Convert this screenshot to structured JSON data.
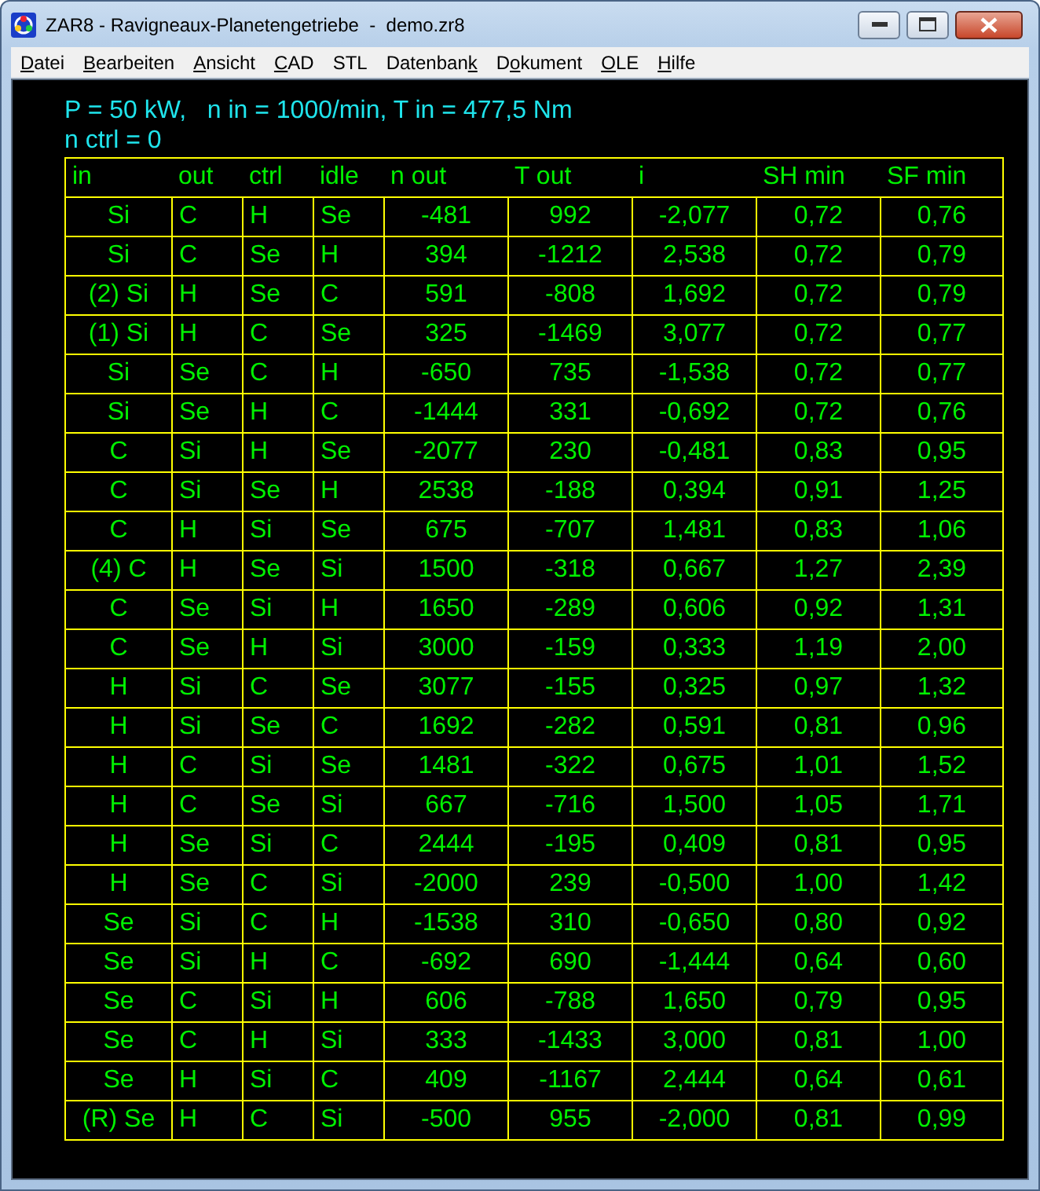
{
  "window": {
    "title": "ZAR8 - Ravigneaux-Planetengetriebe  -  demo.zr8"
  },
  "menu": [
    {
      "parts": [
        {
          "t": "D",
          "key": true
        },
        {
          "t": "atei",
          "key": false
        }
      ]
    },
    {
      "parts": [
        {
          "t": "B",
          "key": true
        },
        {
          "t": "earbeiten",
          "key": false
        }
      ]
    },
    {
      "parts": [
        {
          "t": "A",
          "key": true
        },
        {
          "t": "nsicht",
          "key": false
        }
      ]
    },
    {
      "parts": [
        {
          "t": "C",
          "key": true
        },
        {
          "t": "AD",
          "key": false
        }
      ]
    },
    {
      "parts": [
        {
          "t": "STL",
          "key": false
        }
      ]
    },
    {
      "parts": [
        {
          "t": "Datenban",
          "key": false
        },
        {
          "t": "k",
          "key": true
        }
      ]
    },
    {
      "parts": [
        {
          "t": "D",
          "key": false
        },
        {
          "t": "o",
          "key": true
        },
        {
          "t": "kument",
          "key": false
        }
      ]
    },
    {
      "parts": [
        {
          "t": "O",
          "key": true
        },
        {
          "t": "LE",
          "key": false
        }
      ]
    },
    {
      "parts": [
        {
          "t": "H",
          "key": true
        },
        {
          "t": "ilfe",
          "key": false
        }
      ]
    }
  ],
  "summary": [
    "P = 50 kW,   n in = 1000/min, T in = 477,5 Nm",
    "n ctrl = 0"
  ],
  "table": {
    "columns": [
      "in",
      "out",
      "ctrl",
      "idle",
      "n out",
      "T out",
      "i",
      "SH min",
      "SF min"
    ],
    "rows": [
      [
        "Si",
        "C",
        "H",
        "Se",
        "-481",
        "992",
        "-2,077",
        "0,72",
        "0,76"
      ],
      [
        "Si",
        "C",
        "Se",
        "H",
        "394",
        "-1212",
        "2,538",
        "0,72",
        "0,79"
      ],
      [
        "(2) Si",
        "H",
        "Se",
        "C",
        "591",
        "-808",
        "1,692",
        "0,72",
        "0,79"
      ],
      [
        "(1) Si",
        "H",
        "C",
        "Se",
        "325",
        "-1469",
        "3,077",
        "0,72",
        "0,77"
      ],
      [
        "Si",
        "Se",
        "C",
        "H",
        "-650",
        "735",
        "-1,538",
        "0,72",
        "0,77"
      ],
      [
        "Si",
        "Se",
        "H",
        "C",
        "-1444",
        "331",
        "-0,692",
        "0,72",
        "0,76"
      ],
      [
        "C",
        "Si",
        "H",
        "Se",
        "-2077",
        "230",
        "-0,481",
        "0,83",
        "0,95"
      ],
      [
        "C",
        "Si",
        "Se",
        "H",
        "2538",
        "-188",
        "0,394",
        "0,91",
        "1,25"
      ],
      [
        "C",
        "H",
        "Si",
        "Se",
        "675",
        "-707",
        "1,481",
        "0,83",
        "1,06"
      ],
      [
        "(4) C",
        "H",
        "Se",
        "Si",
        "1500",
        "-318",
        "0,667",
        "1,27",
        "2,39"
      ],
      [
        "C",
        "Se",
        "Si",
        "H",
        "1650",
        "-289",
        "0,606",
        "0,92",
        "1,31"
      ],
      [
        "C",
        "Se",
        "H",
        "Si",
        "3000",
        "-159",
        "0,333",
        "1,19",
        "2,00"
      ],
      [
        "H",
        "Si",
        "C",
        "Se",
        "3077",
        "-155",
        "0,325",
        "0,97",
        "1,32"
      ],
      [
        "H",
        "Si",
        "Se",
        "C",
        "1692",
        "-282",
        "0,591",
        "0,81",
        "0,96"
      ],
      [
        "H",
        "C",
        "Si",
        "Se",
        "1481",
        "-322",
        "0,675",
        "1,01",
        "1,52"
      ],
      [
        "H",
        "C",
        "Se",
        "Si",
        "667",
        "-716",
        "1,500",
        "1,05",
        "1,71"
      ],
      [
        "H",
        "Se",
        "Si",
        "C",
        "2444",
        "-195",
        "0,409",
        "0,81",
        "0,95"
      ],
      [
        "H",
        "Se",
        "C",
        "Si",
        "-2000",
        "239",
        "-0,500",
        "1,00",
        "1,42"
      ],
      [
        "Se",
        "Si",
        "C",
        "H",
        "-1538",
        "310",
        "-0,650",
        "0,80",
        "0,92"
      ],
      [
        "Se",
        "Si",
        "H",
        "C",
        "-692",
        "690",
        "-1,444",
        "0,64",
        "0,60"
      ],
      [
        "Se",
        "C",
        "Si",
        "H",
        "606",
        "-788",
        "1,650",
        "0,79",
        "0,95"
      ],
      [
        "Se",
        "C",
        "H",
        "Si",
        "333",
        "-1433",
        "3,000",
        "0,81",
        "1,00"
      ],
      [
        "Se",
        "H",
        "Si",
        "C",
        "409",
        "-1167",
        "2,444",
        "0,64",
        "0,61"
      ],
      [
        "(R) Se",
        "H",
        "C",
        "Si",
        "-500",
        "955",
        "-2,000",
        "0,81",
        "0,99"
      ]
    ]
  }
}
